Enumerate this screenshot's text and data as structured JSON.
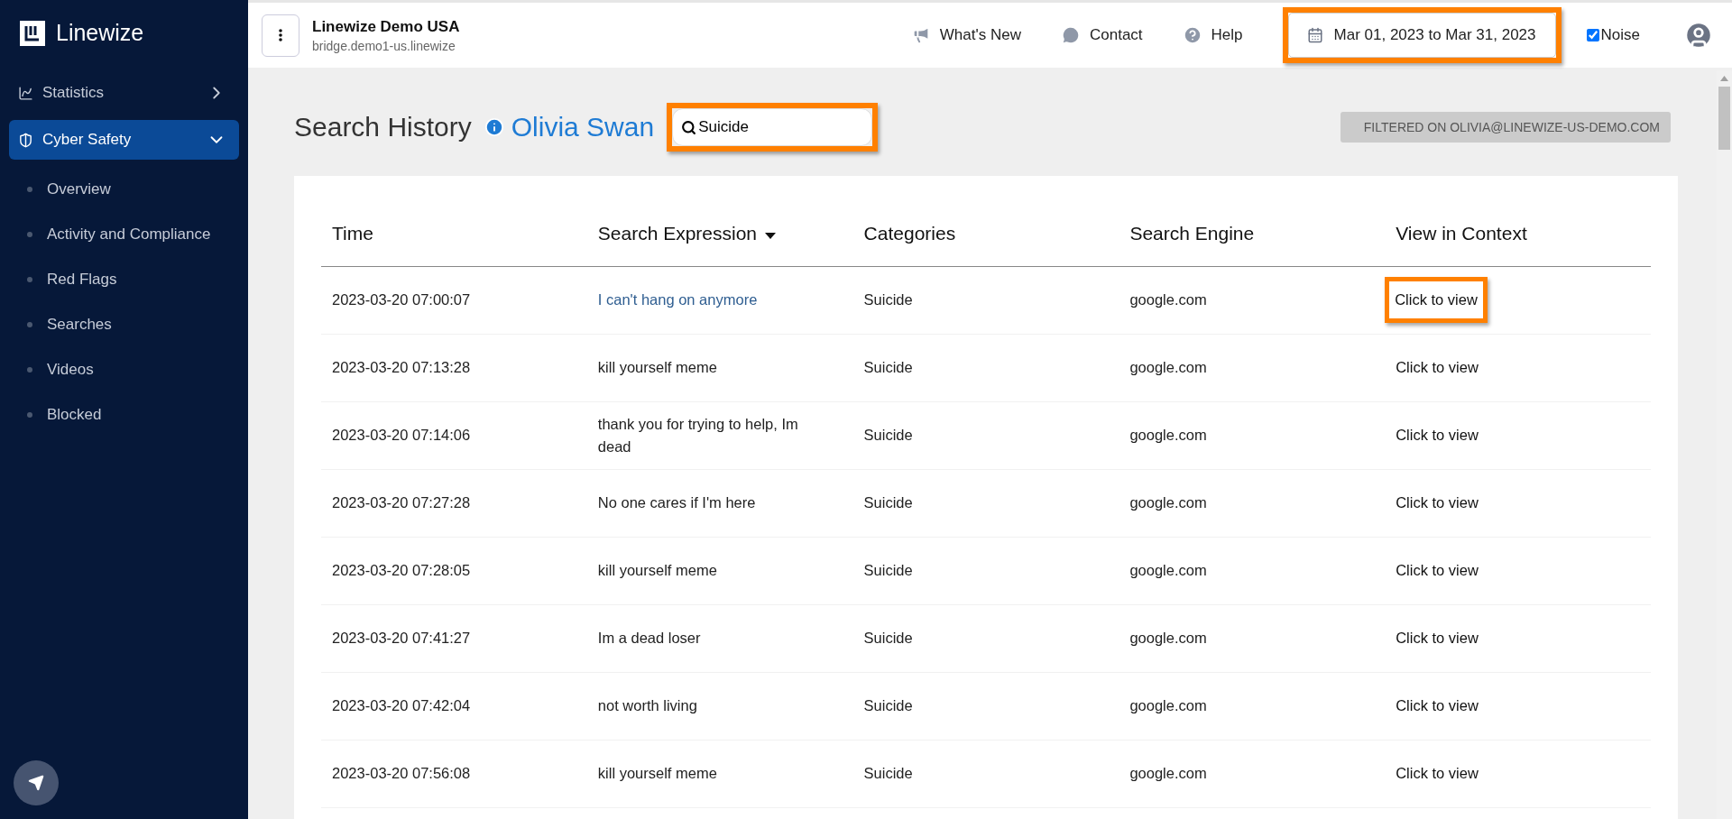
{
  "sidebar": {
    "logo": "Linewize",
    "items": [
      {
        "label": "Statistics",
        "kind": "group",
        "expanded": false,
        "selected": false
      },
      {
        "label": "Cyber Safety",
        "kind": "group",
        "expanded": true,
        "selected": true
      },
      {
        "label": "Overview",
        "kind": "sub",
        "selected": false
      },
      {
        "label": "Activity and Compliance",
        "kind": "sub",
        "selected": false
      },
      {
        "label": "Red Flags",
        "kind": "sub",
        "selected": false
      },
      {
        "label": "Searches",
        "kind": "sub",
        "selected": false
      },
      {
        "label": "Videos",
        "kind": "sub",
        "selected": false
      },
      {
        "label": "Blocked",
        "kind": "sub",
        "selected": false
      }
    ]
  },
  "topbar": {
    "org": "Linewize Demo USA",
    "host": "bridge.demo1-us.linewize",
    "links": [
      "What's New",
      "Contact",
      "Help"
    ],
    "date_range": {
      "value": "Mar 01, 2023 to Mar 31, 2023",
      "highlighted": true
    },
    "noise": {
      "label": "Noise",
      "checked": true
    }
  },
  "page": {
    "title": "Search History",
    "user": "Olivia Swan",
    "search": {
      "value": "Suicide",
      "highlighted": true
    },
    "filter_badge": "FILTERED ON OLIVIA@LINEWIZE-US-DEMO.COM"
  },
  "table": {
    "columns": [
      {
        "label": "Time",
        "sorted": false
      },
      {
        "label": "Search Expression",
        "sorted": true
      },
      {
        "label": "Categories",
        "sorted": false
      },
      {
        "label": "Search Engine",
        "sorted": false
      },
      {
        "label": "View in Context",
        "sorted": false
      }
    ],
    "rows": [
      {
        "time": "2023-03-20 07:00:07",
        "expression": "I can't hang on anymore",
        "hovered": true,
        "category": "Suicide",
        "engine": "google.com",
        "view": "Click to view",
        "highlighted": true
      },
      {
        "time": "2023-03-20 07:13:28",
        "expression": "kill yourself meme",
        "hovered": false,
        "category": "Suicide",
        "engine": "google.com",
        "view": "Click to view",
        "highlighted": false
      },
      {
        "time": "2023-03-20 07:14:06",
        "expression": "thank you for trying to help, Im dead",
        "hovered": false,
        "category": "Suicide",
        "engine": "google.com",
        "view": "Click to view",
        "highlighted": false
      },
      {
        "time": "2023-03-20 07:27:28",
        "expression": "No one cares if I'm here",
        "hovered": false,
        "category": "Suicide",
        "engine": "google.com",
        "view": "Click to view",
        "highlighted": false
      },
      {
        "time": "2023-03-20 07:28:05",
        "expression": "kill yourself meme",
        "hovered": false,
        "category": "Suicide",
        "engine": "google.com",
        "view": "Click to view",
        "highlighted": false
      },
      {
        "time": "2023-03-20 07:41:27",
        "expression": "Im a dead loser",
        "hovered": false,
        "category": "Suicide",
        "engine": "google.com",
        "view": "Click to view",
        "highlighted": false
      },
      {
        "time": "2023-03-20 07:42:04",
        "expression": "not worth living",
        "hovered": false,
        "category": "Suicide",
        "engine": "google.com",
        "view": "Click to view",
        "highlighted": false
      },
      {
        "time": "2023-03-20 07:56:08",
        "expression": "kill yourself meme",
        "hovered": false,
        "category": "Suicide",
        "engine": "google.com",
        "view": "Click to view",
        "highlighted": false
      }
    ]
  }
}
